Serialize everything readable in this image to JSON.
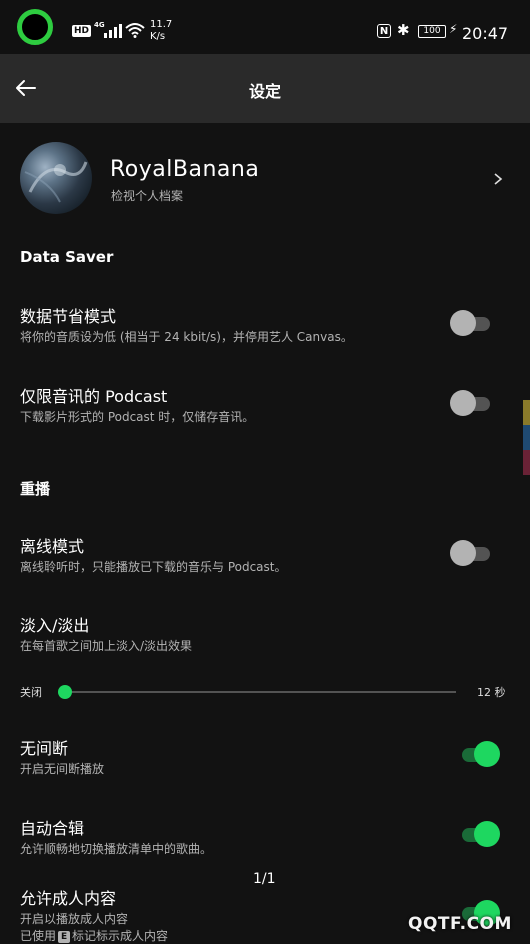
{
  "status_bar": {
    "hd": "HD",
    "network": "4G",
    "speed_value": "11.7",
    "speed_unit": "K/s",
    "nfc": "N",
    "bluetooth": "✱",
    "battery": "100",
    "time": "20:47"
  },
  "header": {
    "title": "设定"
  },
  "profile": {
    "name": "RoyalBanana",
    "subtitle": "检视个人档案"
  },
  "sections": {
    "data_saver": "Data Saver",
    "playback": "重播"
  },
  "items": {
    "data_saver_mode": {
      "title": "数据节省模式",
      "desc": "将你的音质设为低 (相当于 24 kbit/s)，并停用艺人 Canvas。",
      "enabled": false
    },
    "audio_only_podcast": {
      "title": "仅限音讯的 Podcast",
      "desc": "下载影片形式的 Podcast 时，仅储存音讯。",
      "enabled": false
    },
    "offline_mode": {
      "title": "离线模式",
      "desc": "离线聆听时，只能播放已下载的音乐与 Podcast。",
      "enabled": false
    },
    "crossfade": {
      "title": "淡入/淡出",
      "desc": "在每首歌之间加上淡入/淡出效果"
    },
    "gapless": {
      "title": "无间断",
      "desc": "开启无间断播放",
      "enabled": true
    },
    "automix": {
      "title": "自动合辑",
      "desc": "允许顺畅地切换播放清单中的歌曲。",
      "enabled": true
    },
    "explicit": {
      "title": "允许成人内容",
      "desc": "开启以播放成人内容",
      "desc2_before": "已使用",
      "badge": "E",
      "desc2_after": "标记标示成人内容",
      "enabled": true
    }
  },
  "crossfade_slider": {
    "min_label": "关闭",
    "max_label": "12 秒",
    "value_seconds": 0
  },
  "pager": "1/1",
  "watermark": "QQTF.COM",
  "colors": {
    "accent": "#1ed760",
    "background": "#121212",
    "header": "#2a2a2a"
  }
}
